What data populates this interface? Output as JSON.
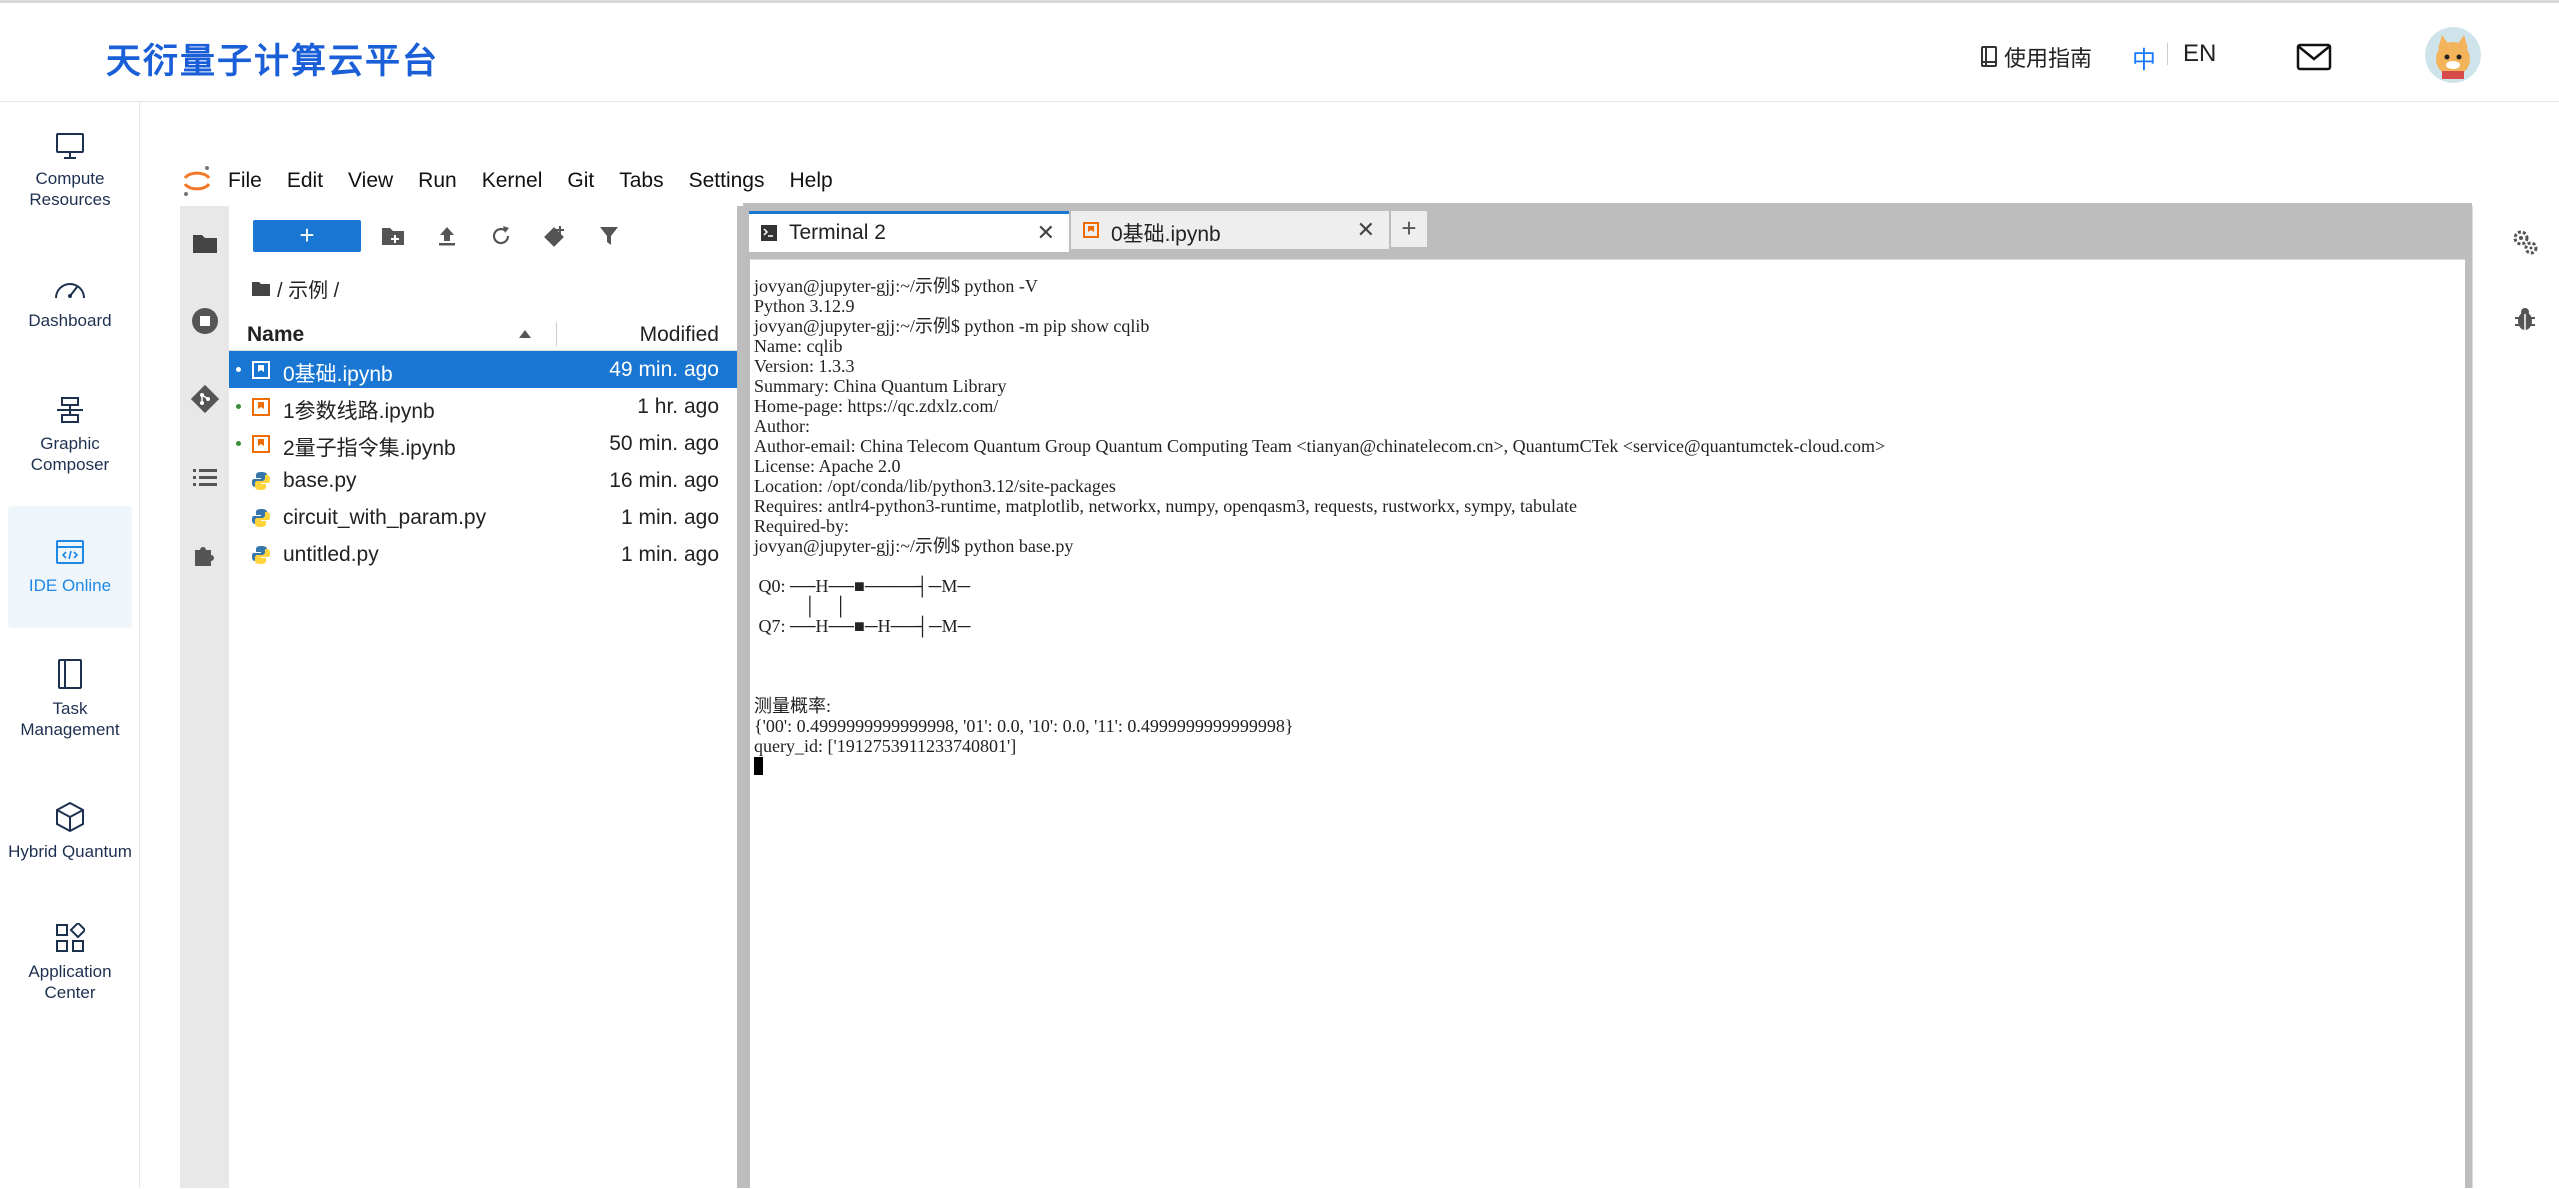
{
  "header": {
    "brand": "天衍量子计算云平台",
    "guide_label": "使用指南",
    "lang_zh": "中",
    "lang_en": "EN"
  },
  "nav": {
    "items": [
      {
        "label": "Compute Resources",
        "icon": "monitor-icon"
      },
      {
        "label": "Dashboard",
        "icon": "gauge-icon"
      },
      {
        "label": "Graphic Composer",
        "icon": "circuit-icon"
      },
      {
        "label": "IDE Online",
        "icon": "code-window-icon"
      },
      {
        "label": "Task Management",
        "icon": "book-icon"
      },
      {
        "label": "Hybrid Quantum",
        "icon": "cube-icon"
      },
      {
        "label": "Application Center",
        "icon": "apps-grid-icon"
      }
    ],
    "active": "IDE Online"
  },
  "menubar": [
    "File",
    "Edit",
    "View",
    "Run",
    "Kernel",
    "Git",
    "Tabs",
    "Settings",
    "Help"
  ],
  "filebrowser": {
    "new_label": "+",
    "breadcrumb": "/ 示例 /",
    "col_name": "Name",
    "col_modified": "Modified",
    "files": [
      {
        "name": "0基础.ipynb",
        "modified": "49 min. ago",
        "type": "notebook",
        "running": true,
        "selected": true
      },
      {
        "name": "1参数线路.ipynb",
        "modified": "1 hr. ago",
        "type": "notebook",
        "running": true,
        "selected": false
      },
      {
        "name": "2量子指令集.ipynb",
        "modified": "50 min. ago",
        "type": "notebook",
        "running": true,
        "selected": false
      },
      {
        "name": "base.py",
        "modified": "16 min. ago",
        "type": "python",
        "running": false,
        "selected": false
      },
      {
        "name": "circuit_with_param.py",
        "modified": "1 min. ago",
        "type": "python",
        "running": false,
        "selected": false
      },
      {
        "name": "untitled.py",
        "modified": "1 min. ago",
        "type": "python",
        "running": false,
        "selected": false
      }
    ]
  },
  "tabs": [
    {
      "label": "Terminal 2",
      "active": true
    },
    {
      "label": "0基础.ipynb",
      "active": false
    }
  ],
  "terminal": {
    "lines": [
      "jovyan@jupyter-gjj:~/示例$ python -V",
      "Python 3.12.9",
      "jovyan@jupyter-gjj:~/示例$ python -m pip show cqlib",
      "Name: cqlib",
      "Version: 1.3.3",
      "Summary: China Quantum Library",
      "Home-page: https://qc.zdxlz.com/",
      "Author:",
      "Author-email: China Telecom Quantum Group Quantum Computing Team <tianyan@chinatelecom.cn>, QuantumCTek <service@quantumctek-cloud.com>",
      "License: Apache 2.0",
      "Location: /opt/conda/lib/python3.12/site-packages",
      "Requires: antlr4-python3-runtime, matplotlib, networkx, numpy, openqasm3, requests, rustworkx, sympy, tabulate",
      "Required-by:",
      "jovyan@jupyter-gjj:~/示例$ python base.py",
      "",
      " Q0: ──H──■────┤─M─",
      "           │    │",
      " Q7: ──H──■─H──┤─M─",
      "",
      "",
      "",
      "测量概率:",
      "{'00': 0.4999999999999998, '01': 0.0, '10': 0.0, '11': 0.4999999999999998}",
      "query_id: ['1912753911233740801']"
    ]
  }
}
